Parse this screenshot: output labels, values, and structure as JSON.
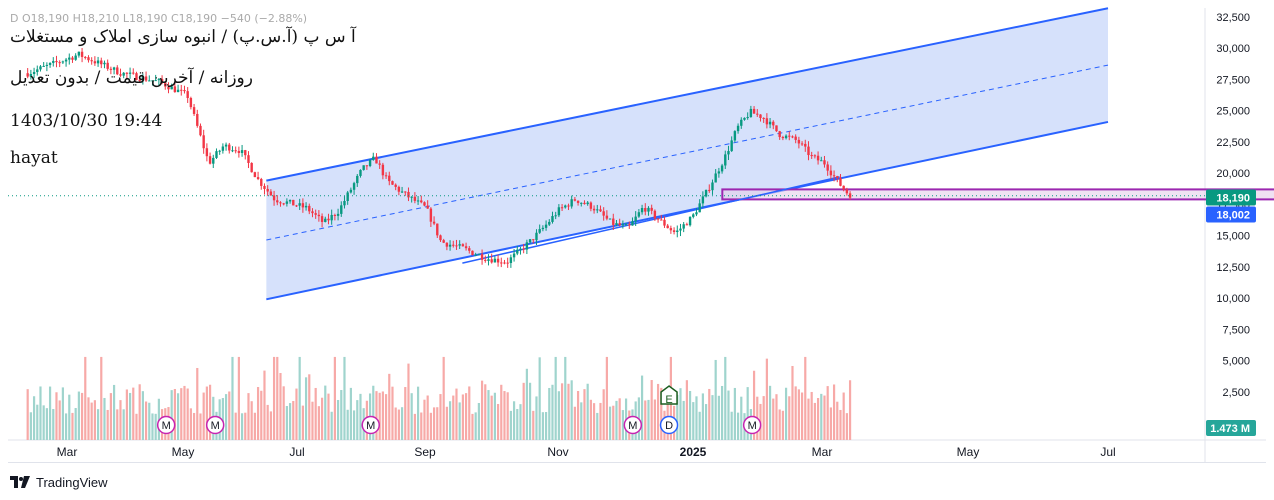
{
  "header": {
    "ohlc_text": "D  O18,190  H18,210  L18,190  C18,190  −540 (−2.88%)",
    "title": "آ س پ (آ.س.پ) / انبوه سازی املاک و مستغلات",
    "subtitle": "روزانه / آخرین قیمت / بدون تعدیل",
    "timestamp": "1403/10/30 19:44",
    "author": "hayat"
  },
  "footer": {
    "brand": "TradingView"
  },
  "chart_data": {
    "type": "candlestick",
    "colors": {
      "up": "#089981",
      "down": "#f23645",
      "up_volume": "#9fd4cd",
      "down_volume": "#f7a9a7",
      "channel_line": "#2962ff",
      "channel_fill": "#cfdcfa",
      "zone_border": "#9c27b0",
      "zone_fill": "#e4cfea"
    },
    "y_axis": {
      "min": 0,
      "max": 32500,
      "ticks": [
        "32,500",
        "30,000",
        "27,500",
        "25,000",
        "22,500",
        "20,000",
        "17,500",
        "15,000",
        "12,500",
        "10,000",
        "7,500",
        "5,000",
        "2,500"
      ]
    },
    "x_axis": {
      "labels": [
        "Mar",
        "May",
        "Jul",
        "Sep",
        "Nov",
        "2025",
        "Mar",
        "May",
        "Jul"
      ]
    },
    "price_labels": [
      {
        "value": "18,190",
        "color": "#089981"
      },
      {
        "value": "18,002",
        "color": "#2962ff"
      }
    ],
    "volume_label": {
      "value": "1.473 M",
      "color": "#26a69a"
    },
    "last_price": 18190,
    "channel": {
      "start_date": "2024-06-01",
      "end_date": "2025-07-01",
      "upper_start": 19400,
      "upper_end": 33200,
      "lower_start": 9900,
      "lower_end": 24100
    },
    "channel_trendline": {
      "start_date": "2024-09-01",
      "start": 12800,
      "end_date": "2025-02-25",
      "end": 19700
    },
    "support_zone": {
      "start_date": "2025-01-01",
      "end_date": "2025-09-20",
      "low": 17900,
      "high": 18700
    },
    "markers": [
      {
        "date": "2024-04-15",
        "letter": "M"
      },
      {
        "date": "2024-05-08",
        "letter": "M"
      },
      {
        "date": "2024-07-20",
        "letter": "M"
      },
      {
        "date": "2024-11-20",
        "letter": "M"
      },
      {
        "date": "2024-12-07",
        "letter": "D"
      },
      {
        "date": "2024-12-07",
        "letter": "E"
      },
      {
        "date": "2025-01-15",
        "letter": "M"
      }
    ],
    "price_path": [
      [
        "2024-02-10",
        28000
      ],
      [
        "2024-03-05",
        29500
      ],
      [
        "2024-03-25",
        28000
      ],
      [
        "2024-04-12",
        27300
      ],
      [
        "2024-04-25",
        26200
      ],
      [
        "2024-05-05",
        20800
      ],
      [
        "2024-05-12",
        22200
      ],
      [
        "2024-05-20",
        21800
      ],
      [
        "2024-05-28",
        19500
      ],
      [
        "2024-06-05",
        17900
      ],
      [
        "2024-06-12",
        17600
      ],
      [
        "2024-06-20",
        17200
      ],
      [
        "2024-06-28",
        16000
      ],
      [
        "2024-07-05",
        17000
      ],
      [
        "2024-07-10",
        18500
      ],
      [
        "2024-07-16",
        20300
      ],
      [
        "2024-07-22",
        21200
      ],
      [
        "2024-07-28",
        19300
      ],
      [
        "2024-08-05",
        18300
      ],
      [
        "2024-08-15",
        17200
      ],
      [
        "2024-08-22",
        14500
      ],
      [
        "2024-09-01",
        14000
      ],
      [
        "2024-09-12",
        13200
      ],
      [
        "2024-09-22",
        12900
      ],
      [
        "2024-10-02",
        14400
      ],
      [
        "2024-10-10",
        15800
      ],
      [
        "2024-10-16",
        17000
      ],
      [
        "2024-10-24",
        17900
      ],
      [
        "2024-11-01",
        17300
      ],
      [
        "2024-11-10",
        16000
      ],
      [
        "2024-11-18",
        15600
      ],
      [
        "2024-11-25",
        17300
      ],
      [
        "2024-12-02",
        16300
      ],
      [
        "2024-12-10",
        15200
      ],
      [
        "2024-12-18",
        16500
      ],
      [
        "2024-12-25",
        18600
      ],
      [
        "2025-01-02",
        21200
      ],
      [
        "2025-01-08",
        23600
      ],
      [
        "2025-01-14",
        24900
      ],
      [
        "2025-01-20",
        24500
      ],
      [
        "2025-01-28",
        23100
      ],
      [
        "2025-02-05",
        22600
      ],
      [
        "2025-02-12",
        21300
      ],
      [
        "2025-02-18",
        20800
      ],
      [
        "2025-02-23",
        19600
      ],
      [
        "2025-02-28",
        18500
      ],
      [
        "2025-03-03",
        18190
      ]
    ]
  }
}
